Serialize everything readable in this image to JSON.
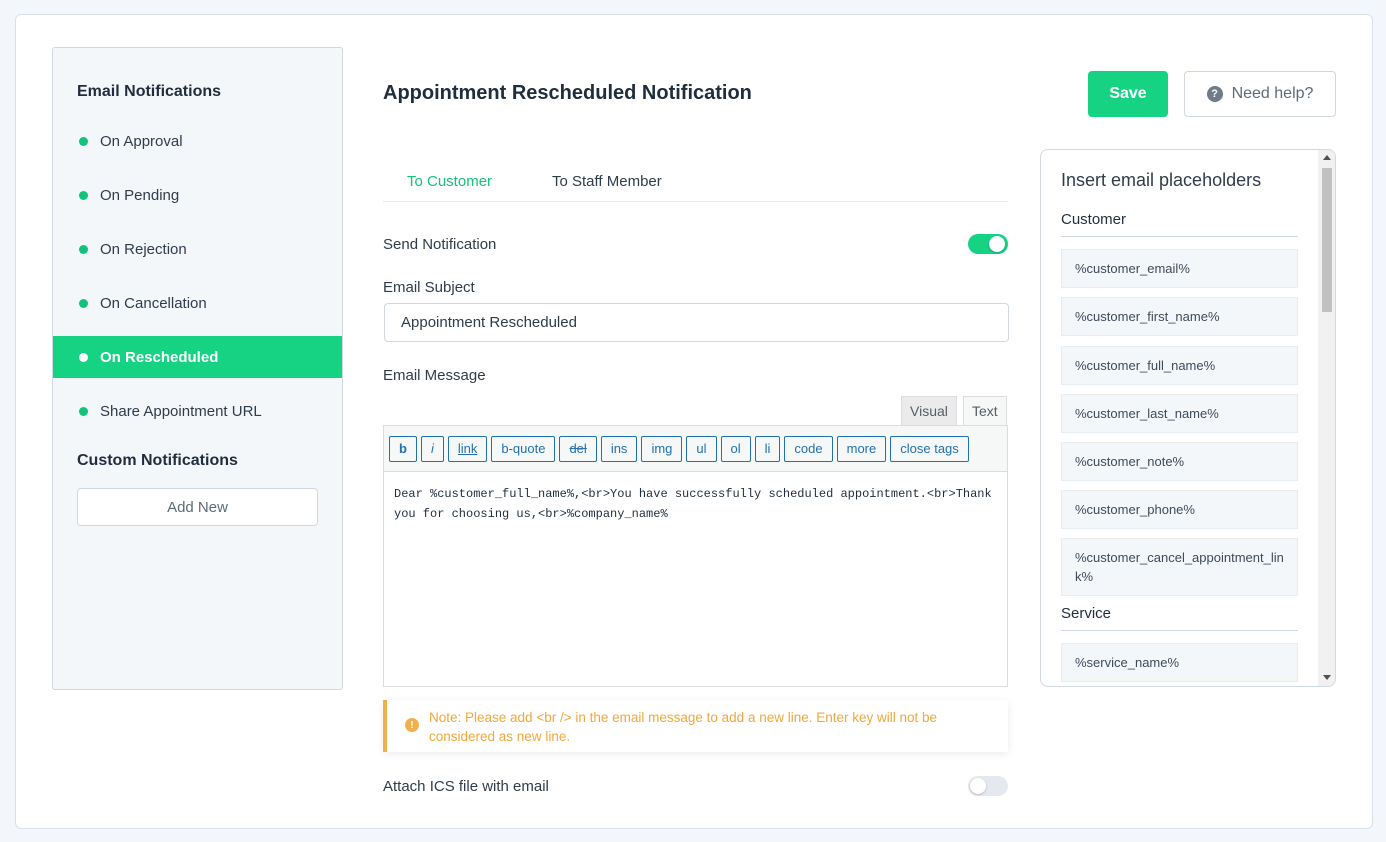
{
  "sidebar": {
    "email_heading": "Email Notifications",
    "items": [
      {
        "label": "On Approval",
        "active": false
      },
      {
        "label": "On Pending",
        "active": false
      },
      {
        "label": "On Rejection",
        "active": false
      },
      {
        "label": "On Cancellation",
        "active": false
      },
      {
        "label": "On Rescheduled",
        "active": true
      },
      {
        "label": "Share Appointment URL",
        "active": false
      }
    ],
    "custom_heading": "Custom Notifications",
    "add_new_label": "Add New"
  },
  "header": {
    "title": "Appointment Rescheduled Notification",
    "save_label": "Save",
    "help_label": "Need help?"
  },
  "tabs": [
    {
      "label": "To Customer",
      "active": true
    },
    {
      "label": "To Staff Member",
      "active": false
    }
  ],
  "form": {
    "send_notification_label": "Send Notification",
    "send_notification_on": true,
    "subject_label": "Email Subject",
    "subject_value": "Appointment Rescheduled",
    "message_label": "Email Message",
    "editor_tabs": {
      "visual": "Visual",
      "text": "Text"
    },
    "toolbar_buttons": [
      "b",
      "i",
      "link",
      "b-quote",
      "del",
      "ins",
      "img",
      "ul",
      "ol",
      "li",
      "code",
      "more",
      "close tags"
    ],
    "message_value": "Dear %customer_full_name%,<br>You have successfully scheduled appointment.<br>Thank you for choosing us,<br>%company_name%",
    "note": "Note: Please add <br /> in the email message to add a new line. Enter key will not be considered as new line.",
    "attach_ics_label": "Attach ICS file with email",
    "attach_ics_on": false
  },
  "placeholders": {
    "title": "Insert email placeholders",
    "groups": [
      {
        "name": "Customer",
        "items": [
          "%customer_email%",
          "%customer_first_name%",
          "%customer_full_name%",
          "%customer_last_name%",
          "%customer_note%",
          "%customer_phone%",
          "%customer_cancel_appointment_link%"
        ]
      },
      {
        "name": "Service",
        "items": [
          "%service_name%"
        ]
      }
    ]
  },
  "colors": {
    "accent": "#15d383",
    "note": "#f0b04a"
  }
}
